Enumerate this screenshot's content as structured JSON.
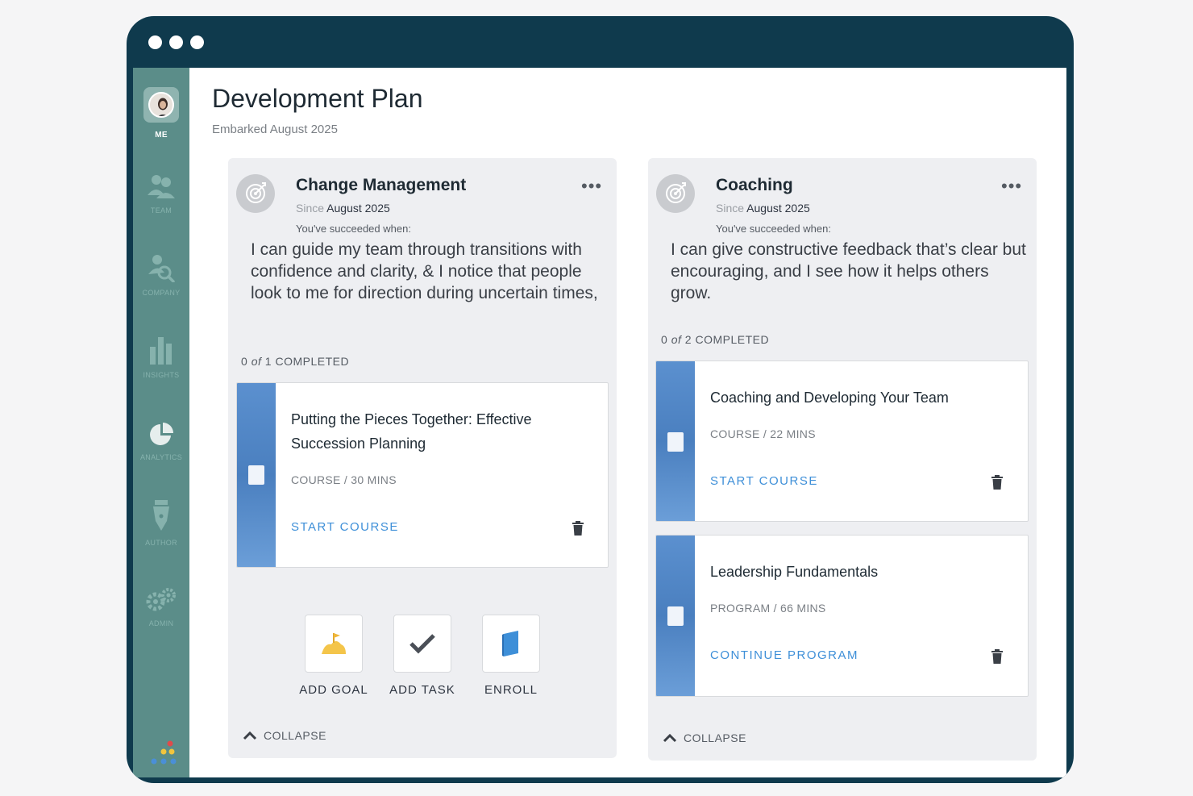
{
  "window": {
    "dots": 3
  },
  "sidebar": {
    "items": [
      {
        "label": "ME",
        "icon": "avatar"
      },
      {
        "label": "TEAM",
        "icon": "team-icon"
      },
      {
        "label": "COMPANY",
        "icon": "company-search-icon"
      },
      {
        "label": "INSIGHTS",
        "icon": "bar-chart-icon"
      },
      {
        "label": "ANALYTICS",
        "icon": "pie-chart-icon"
      },
      {
        "label": "AUTHOR",
        "icon": "pen-nib-icon"
      },
      {
        "label": "ADMIN",
        "icon": "gears-icon"
      }
    ]
  },
  "page": {
    "title": "Development Plan",
    "subtitle": "Embarked August 2025"
  },
  "goals": [
    {
      "title": "Change Management",
      "since_prefix": "Since",
      "since_date": "August 2025",
      "succeed_label": "You've succeeded when:",
      "succeed_text": "I can guide my team through transitions with confidence and clarity, & I notice that people look to me for direction during uncertain times,",
      "completed_count": "0",
      "completed_of": "of",
      "completed_total": "1",
      "completed_label": "COMPLETED",
      "courses": [
        {
          "title": "Putting the Pieces Together: Effective Succession Planning",
          "meta": "COURSE / 30 MINS",
          "action": "START COURSE"
        }
      ],
      "actions": [
        {
          "label": "ADD GOAL",
          "icon": "goal-flag-icon"
        },
        {
          "label": "ADD TASK",
          "icon": "checkmark-icon"
        },
        {
          "label": "ENROLL",
          "icon": "book-icon"
        }
      ],
      "collapse_label": "COLLAPSE"
    },
    {
      "title": "Coaching",
      "since_prefix": "Since",
      "since_date": "August 2025",
      "succeed_label": "You've succeeded when:",
      "succeed_text": "I can give constructive feedback that’s clear but encouraging, and I see how it helps others grow.",
      "completed_count": "0",
      "completed_of": "of",
      "completed_total": "2",
      "completed_label": "COMPLETED",
      "courses": [
        {
          "title": "Coaching and Developing Your Team",
          "meta": "COURSE / 22 MINS",
          "action": "START COURSE"
        },
        {
          "title": "Leadership Fundamentals",
          "meta": "PROGRAM / 66 MINS",
          "action": "CONTINUE PROGRAM"
        }
      ],
      "collapse_label": "COLLAPSE"
    }
  ],
  "colors": {
    "frame": "#0f3a4d",
    "sidebar": "#5b8d89",
    "link": "#3e8fd8",
    "card": "#eeeff2"
  }
}
